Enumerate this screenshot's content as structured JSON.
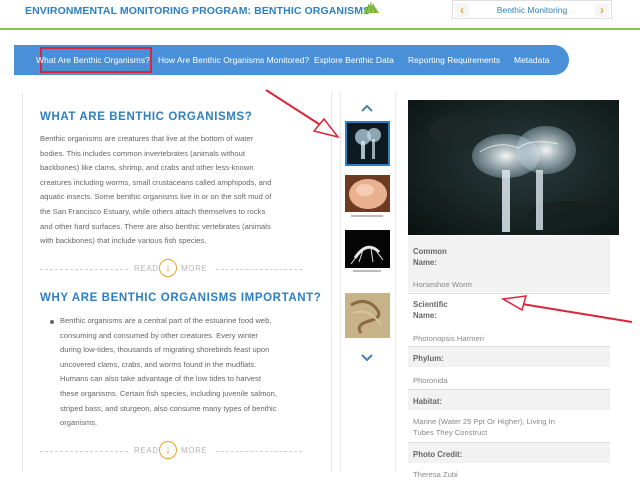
{
  "header": {
    "site_title": "ENVIRONMENTAL MONITORING PROGRAM: BENTHIC ORGANISMS",
    "selector_label": "Benthic Monitoring",
    "prev_icon": "chevron-left-icon",
    "next_icon": "chevron-right-icon"
  },
  "nav": {
    "items": [
      {
        "label": "What Are Benthic Organisms?",
        "active": true
      },
      {
        "label": "How Are Benthic Organisms Monitored?"
      },
      {
        "label": "Explore Benthic Data"
      },
      {
        "label": "Reporting Requirements"
      },
      {
        "label": "Metadata"
      }
    ]
  },
  "main": {
    "section1": {
      "heading": "WHAT ARE BENTHIC ORGANISMS?",
      "lines": [
        "Benthic organisms are creatures that live at the bottom of water",
        "bodies. This includes common invertebrates (animals without",
        "backbones) like clams, shrimp, and crabs and other less-known",
        "creatures including worms, small crustaceans called amphipods, and",
        "aquatic insects. Some benthic organisms live in or on the soft mud of",
        "the San Francisco Estuary, while others attach themselves to rocks",
        "and other hard surfaces. There are also benthic vertebrates (animals",
        "with backbones) that include various fish species."
      ]
    },
    "read_more_left": "READ",
    "read_more_right": "MORE",
    "section2": {
      "heading": "WHY ARE BENTHIC ORGANISMS IMPORTANT?",
      "lines": [
        "Benthic organisms are a central part of the estuarine food web,",
        "consuming and consumed by other creatures. Every winter",
        "during low-tides, thousands of migrating shorebirds feast upon",
        "uncovered clams, crabs, and worms found in the mudflats.",
        "Humans can also take advantage of the low tides to harvest",
        "these organisms. Certain fish species, including juvenile salmon,",
        "striped bass, and sturgeon, also consume many types of benthic",
        "organisms."
      ]
    }
  },
  "gallery": {
    "up_icon": "chevron-up-icon",
    "down_icon": "chevron-down-icon"
  },
  "details": {
    "common_name_label_1": "Common",
    "common_name_label_2": "Name:",
    "common_name": "Horseshoe Worm",
    "scientific_name_label_1": "Scientific",
    "scientific_name_label_2": "Name:",
    "scientific_name": "Photonopsis Harmeri",
    "phylum_label": "Phylum:",
    "phylum": "Phoronida",
    "habitat_label": "Habitat:",
    "habitat_line1": "Marine (Water 25 Ppt Or Higher), Living In",
    "habitat_line2": "Tubes They Construct",
    "photo_credit_label": "Photo Credit:",
    "photo_credit": "Theresa Zubi"
  },
  "colors": {
    "brand_blue": "#2e7fc1",
    "nav_blue": "#4a90d9",
    "accent_orange": "#e6a623",
    "annotation_red": "#d9263a",
    "header_rule_green": "#8bc34a"
  }
}
